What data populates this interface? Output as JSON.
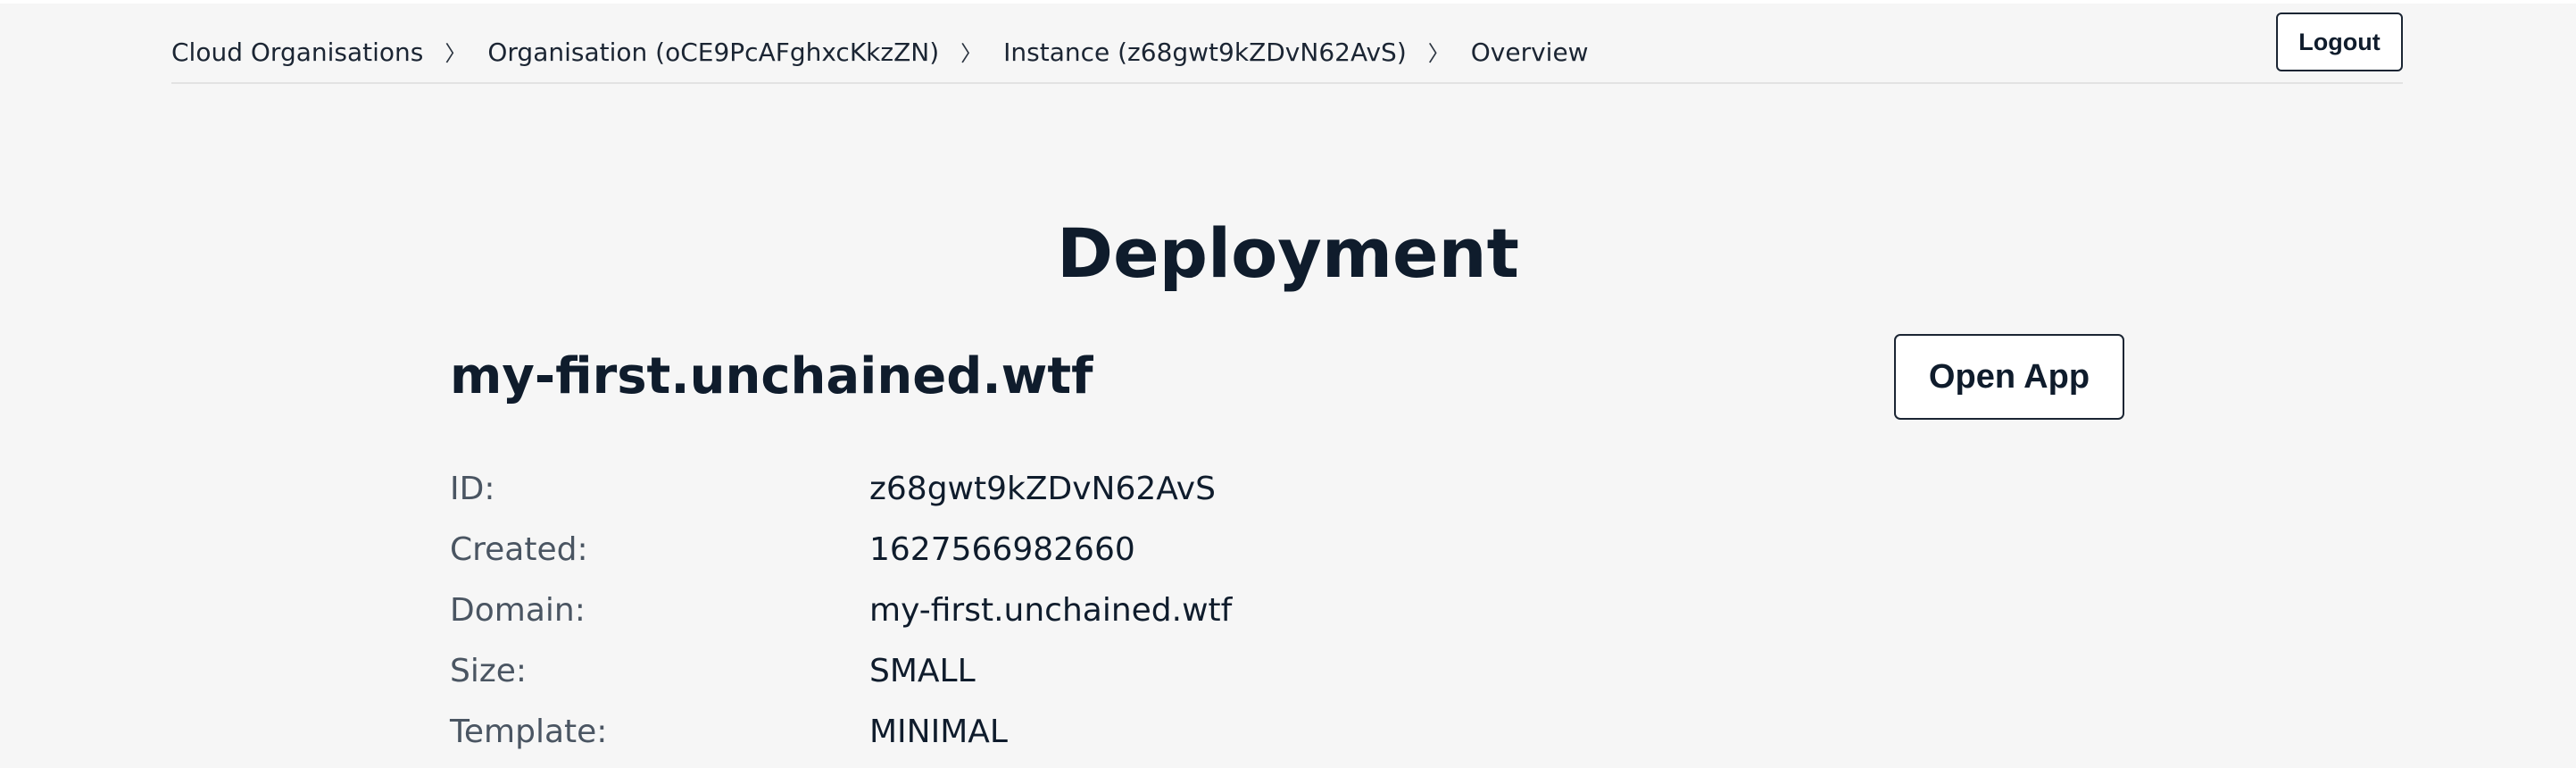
{
  "breadcrumb": {
    "items": [
      {
        "label": "Cloud Organisations"
      },
      {
        "label": "Organisation (oCE9PcAFghxcKkzZN)"
      },
      {
        "label": "Instance (z68gwt9kZDvN62AvS)"
      },
      {
        "label": "Overview"
      }
    ],
    "separator": "〉"
  },
  "header": {
    "logout_label": "Logout"
  },
  "main": {
    "title": "Deployment",
    "domain_heading": "my-first.unchained.wtf",
    "open_app_label": "Open App",
    "details": [
      {
        "label": "ID:",
        "value": "z68gwt9kZDvN62AvS"
      },
      {
        "label": "Created:",
        "value": "1627566982660"
      },
      {
        "label": "Domain:",
        "value": "my-first.unchained.wtf"
      },
      {
        "label": "Size:",
        "value": "SMALL"
      },
      {
        "label": "Template:",
        "value": "MINIMAL"
      }
    ]
  }
}
